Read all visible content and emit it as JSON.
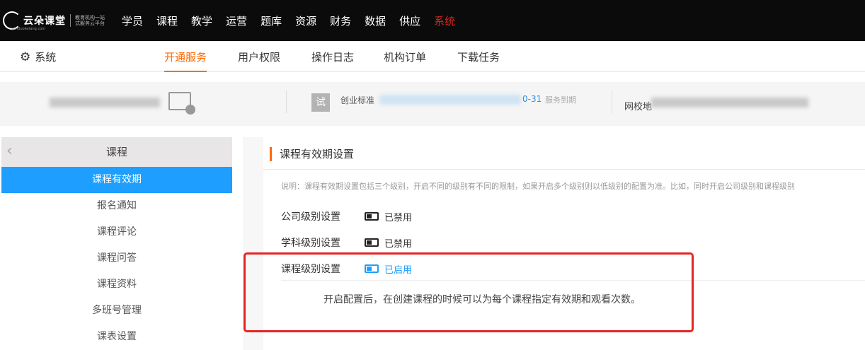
{
  "brand": {
    "name": "云朵课堂",
    "tagline": "教育机构一站式服务云平台",
    "url": "yunduoketang.com"
  },
  "topnav": [
    "学员",
    "课程",
    "教学",
    "运营",
    "题库",
    "资源",
    "财务",
    "数据",
    "供应",
    "系统"
  ],
  "topnav_active": "系统",
  "section": {
    "title": "系统",
    "icon": "gear-icon"
  },
  "subtabs": [
    "开通服务",
    "用户权限",
    "操作日志",
    "机构订单",
    "下载任务"
  ],
  "subtab_active": "开通服务",
  "info": {
    "trial_badge": "试",
    "plan_label": "创业标准",
    "expire_fragment": "0-31",
    "expire_note": "服务到期",
    "school_label": "网校地"
  },
  "side": {
    "title": "课程",
    "items": [
      "课程有效期",
      "报名通知",
      "课程评论",
      "课程问答",
      "课程资料",
      "多班号管理",
      "课表设置"
    ],
    "active": "课程有效期"
  },
  "panel": {
    "title": "课程有效期设置",
    "description": "说明：课程有效期设置包括三个级别，开启不同的级别有不同的限制，如果开启多个级别则以低级别的配置为准。比如，同时开启公司级别和课程级别",
    "settings": [
      {
        "label": "公司级别设置",
        "status": "已禁用",
        "enabled": false
      },
      {
        "label": "学科级别设置",
        "status": "已禁用",
        "enabled": false
      },
      {
        "label": "课程级别设置",
        "status": "已启用",
        "enabled": true
      }
    ],
    "hint": "开启配置后，在创建课程的时候可以为每个课程指定有效期和观看次数。"
  },
  "colors": {
    "accent": "#ff6a00",
    "active_blue": "#1e9fff",
    "nav_active": "#e0211d",
    "highlight": "#e52424"
  }
}
